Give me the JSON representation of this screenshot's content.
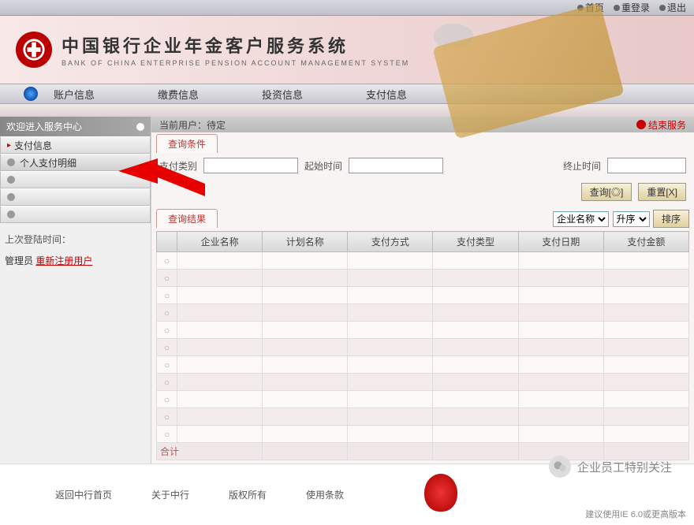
{
  "topLinks": {
    "home": "首页",
    "relogin": "重登录",
    "exit": "退出"
  },
  "banner": {
    "title": "中国银行企业年金客户服务系统",
    "subtitle": "BANK OF CHINA ENTERPRISE PENSION ACCOUNT MANAGEMENT SYSTEM"
  },
  "nav": {
    "acct": "账户信息",
    "fee": "缴费信息",
    "invest": "投资信息",
    "pay": "支付信息"
  },
  "sidebar": {
    "welcome": "欢迎进入服务中心",
    "payInfo": "支付信息",
    "payDetail": "个人支付明细",
    "lastLoginLabel": "上次登陆时间：",
    "adminLabel": "管理员",
    "adminLink": "重新注册用户"
  },
  "userbar": {
    "current": "当前用户：待定",
    "logout": "结束服务"
  },
  "query": {
    "conditionTab": "查询条件",
    "payCategory": "支付类别",
    "startTime": "起始时间",
    "endTime": "终止时间",
    "searchBtn": "查询[◎]",
    "resetBtn": "重置[X]",
    "resultTab": "查询结果",
    "sortSelect": "企业名称",
    "orderSelect": "升序",
    "sortBtn": "排序"
  },
  "table": {
    "cols": {
      "company": "企业名称",
      "plan": "计划名称",
      "method": "支付方式",
      "type": "支付类型",
      "date": "支付日期",
      "amount": "支付金额"
    },
    "sumLabel": "合计"
  },
  "footer": {
    "backHome": "返回中行首页",
    "about": "关于中行",
    "copyright": "版权所有",
    "terms": "使用条款",
    "note": "建议使用IE 6.0或更高版本"
  },
  "watermark": "企业员工特别关注"
}
